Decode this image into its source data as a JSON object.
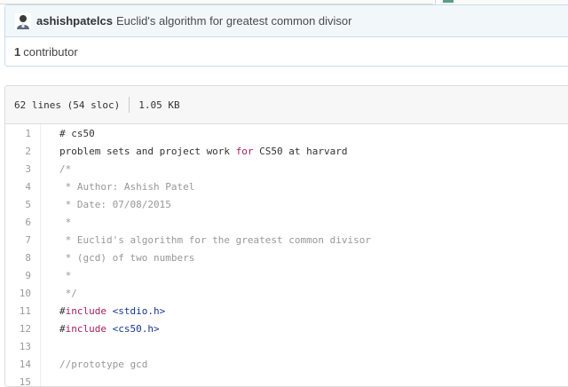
{
  "commit": {
    "author": "ashishpatelcs",
    "message": "Euclid's algorithm for greatest common divisor",
    "contributors_count": "1",
    "contributors_label": "contributor"
  },
  "file": {
    "lines_info": "62 lines (54 sloc)",
    "size": "1.05 KB"
  },
  "code_lines": [
    {
      "n": "1",
      "text": "# cs50"
    },
    {
      "n": "2",
      "text": "problem sets and project work for CS50 at harvard"
    },
    {
      "n": "3",
      "text": "/*"
    },
    {
      "n": "4",
      "text": " * Author: Ashish Patel"
    },
    {
      "n": "5",
      "text": " * Date: 07/08/2015"
    },
    {
      "n": "6",
      "text": " *"
    },
    {
      "n": "7",
      "text": " * Euclid's algorithm for the greatest common divisor"
    },
    {
      "n": "8",
      "text": " * (gcd) of two numbers"
    },
    {
      "n": "9",
      "text": " *"
    },
    {
      "n": "10",
      "text": " */"
    },
    {
      "n": "11",
      "text": "#include <stdio.h>"
    },
    {
      "n": "12",
      "text": "#include <cs50.h>"
    },
    {
      "n": "13",
      "text": ""
    },
    {
      "n": "14",
      "text": "//prototype gcd"
    },
    {
      "n": "15",
      "text": ""
    }
  ]
}
